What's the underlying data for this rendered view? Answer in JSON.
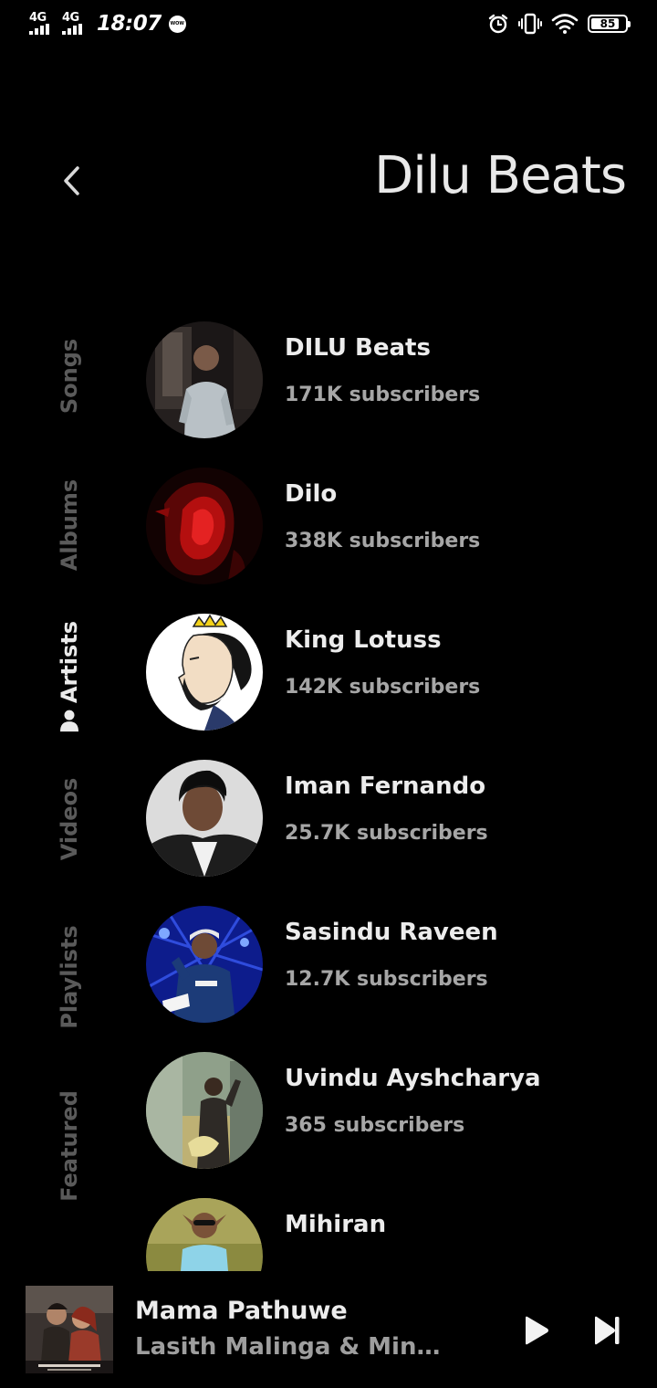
{
  "status_bar": {
    "network_1": "4G",
    "network_2": "4G",
    "time": "18:07",
    "carrier_badge": "WOW",
    "battery_percent": "85",
    "battery_level": 0.85
  },
  "header": {
    "title": "Dilu Beats"
  },
  "categories": [
    {
      "label": "Songs"
    },
    {
      "label": "Albums"
    },
    {
      "label": "Artists"
    },
    {
      "label": "Videos"
    },
    {
      "label": "Playlists"
    },
    {
      "label": "Featured"
    }
  ],
  "active_category": "Artists",
  "artists": [
    {
      "name": "DILU Beats",
      "subscribers": "171K subscribers"
    },
    {
      "name": "Dilo",
      "subscribers": "338K subscribers"
    },
    {
      "name": "King Lotuss",
      "subscribers": "142K subscribers"
    },
    {
      "name": "Iman Fernando",
      "subscribers": "25.7K subscribers"
    },
    {
      "name": "Sasindu Raveen",
      "subscribers": "12.7K subscribers"
    },
    {
      "name": "Uvindu Ayshcharya",
      "subscribers": "365 subscribers"
    },
    {
      "name": "Mihiran",
      "subscribers": ""
    }
  ],
  "now_playing": {
    "title": "Mama Pathuwe",
    "artist": "Lasith Malinga & Minur..."
  },
  "colors": {
    "background": "#000000",
    "active_text": "#eaeaea",
    "inactive_text": "#5a5a5a",
    "secondary_text": "#a6a6a6"
  }
}
